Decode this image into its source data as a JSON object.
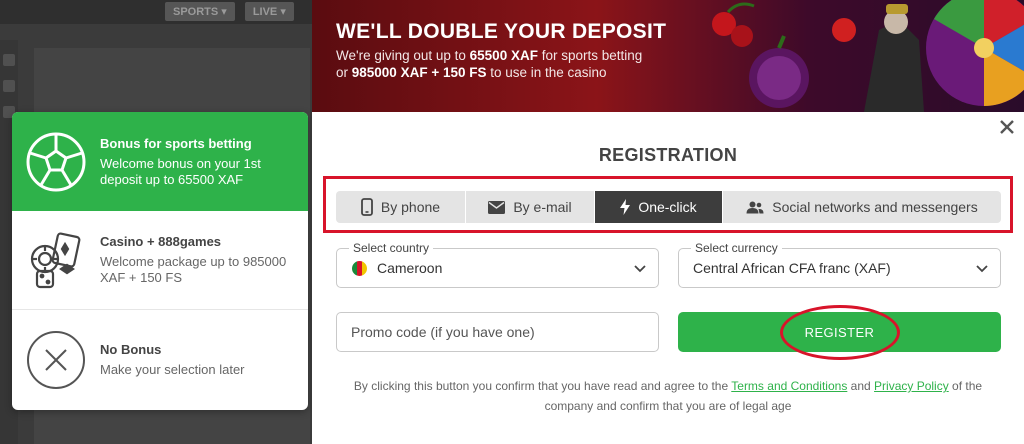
{
  "background": {
    "nav": [
      "SPORTS ▾",
      "LIVE ▾"
    ]
  },
  "banner": {
    "title": "WE'LL DOUBLE YOUR DEPOSIT",
    "line1_prefix": "We're giving out up to ",
    "line1_amount": "65500 XAF",
    "line1_suffix": " for sports betting",
    "line2_prefix": "or ",
    "line2_amount": "985000 XAF + 150 FS",
    "line2_suffix": " to use in the casino"
  },
  "bonuses": [
    {
      "title": "Bonus for sports betting",
      "desc": "Welcome bonus on your 1st deposit up to 65500 XAF",
      "icon": "soccer-ball-icon",
      "active": true
    },
    {
      "title": "Casino + 888games",
      "desc": "Welcome package up to 985000 XAF + 150 FS",
      "icon": "casino-chips-cards-icon",
      "active": false
    },
    {
      "title": "No Bonus",
      "desc": "Make your selection later",
      "icon": "no-bonus-x-icon",
      "active": false
    }
  ],
  "modal": {
    "title": "REGISTRATION",
    "tabs": [
      {
        "label": "By phone",
        "icon": "phone-icon"
      },
      {
        "label": "By e-mail",
        "icon": "envelope-icon"
      },
      {
        "label": "One-click",
        "icon": "lightning-icon",
        "active": true
      },
      {
        "label": "Social networks and messengers",
        "icon": "users-icon"
      }
    ],
    "country": {
      "label": "Select country",
      "value": "Cameroon"
    },
    "currency": {
      "label": "Select currency",
      "value": "Central African CFA franc (XAF)"
    },
    "promo": {
      "placeholder": "Promo code (if you have one)",
      "value": ""
    },
    "register_label": "REGISTER",
    "legal": {
      "prefix": "By clicking this button you confirm that you have read and agree to the ",
      "terms": "Terms and Conditions",
      "and": " and ",
      "privacy": "Privacy Policy",
      "suffix": " of the company and confirm that you are of legal age"
    }
  },
  "colors": {
    "accent_green": "#2eb24a",
    "highlight_red": "#d8142a",
    "active_tab": "#3d3d3d"
  }
}
